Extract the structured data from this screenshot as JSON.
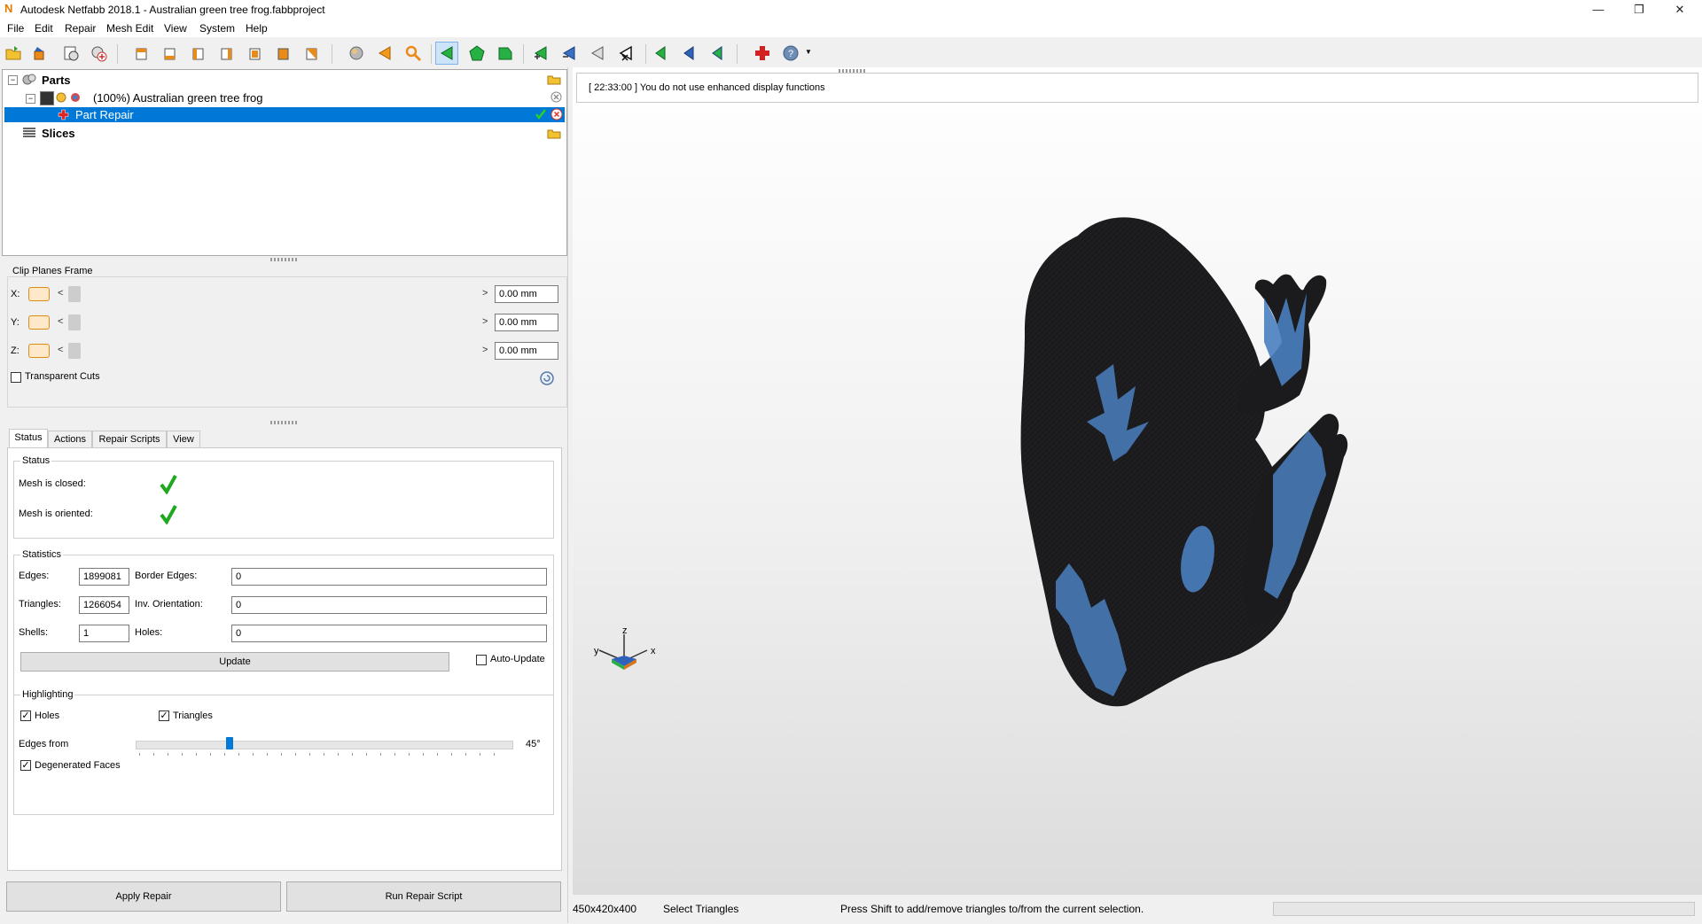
{
  "window": {
    "title": "Autodesk Netfabb 2018.1 - Australian green tree frog.fabbproject",
    "logo_letter": "N"
  },
  "menu": [
    "File",
    "Edit",
    "Repair",
    "Mesh Edit",
    "View",
    "System",
    "Help"
  ],
  "tree": {
    "parts_label": "Parts",
    "part_label": "(100%) Australian green tree frog",
    "repair_label": "Part Repair",
    "slices_label": "Slices"
  },
  "clip": {
    "title": "Clip Planes Frame",
    "x_label": "X:",
    "y_label": "Y:",
    "z_label": "Z:",
    "x_value": "0.00 mm",
    "y_value": "0.00 mm",
    "z_value": "0.00 mm",
    "left_arrow": "<",
    "right_arrow": ">",
    "transparent_label": "Transparent Cuts"
  },
  "tabs": [
    "Status",
    "Actions",
    "Repair Scripts",
    "View"
  ],
  "status": {
    "group_title": "Status",
    "closed_label": "Mesh is closed:",
    "oriented_label": "Mesh is oriented:"
  },
  "statistics": {
    "group_title": "Statistics",
    "edges_label": "Edges:",
    "edges_value": "1899081",
    "border_edges_label": "Border Edges:",
    "border_edges_value": "0",
    "triangles_label": "Triangles:",
    "triangles_value": "1266054",
    "inv_orientation_label": "Inv. Orientation:",
    "inv_orientation_value": "0",
    "shells_label": "Shells:",
    "shells_value": "1",
    "holes_label": "Holes:",
    "holes_value": "0",
    "update_label": "Update",
    "auto_update_label": "Auto-Update"
  },
  "highlighting": {
    "group_title": "Highlighting",
    "holes_label": "Holes",
    "triangles_label": "Triangles",
    "edges_from_label": "Edges from",
    "edges_from_value": "45°",
    "slider_fraction": 0.25,
    "degenerated_label": "Degenerated Faces"
  },
  "buttons": {
    "apply_repair": "Apply Repair",
    "run_repair_script": "Run Repair Script"
  },
  "viewport": {
    "log_message": "[ 22:33:00 ] You do not use enhanced display functions",
    "axis_x": "x",
    "axis_y": "y",
    "axis_z": "z"
  },
  "statusbar": {
    "dimensions": "450x420x400",
    "mode": "Select Triangles",
    "hint": "Press Shift to add/remove triangles to/from the current selection."
  },
  "colors": {
    "selection_blue": "#0078d7",
    "model_dark": "#1b1b1d",
    "model_blue": "#4a7fbf",
    "check_green": "#1fa81f"
  }
}
